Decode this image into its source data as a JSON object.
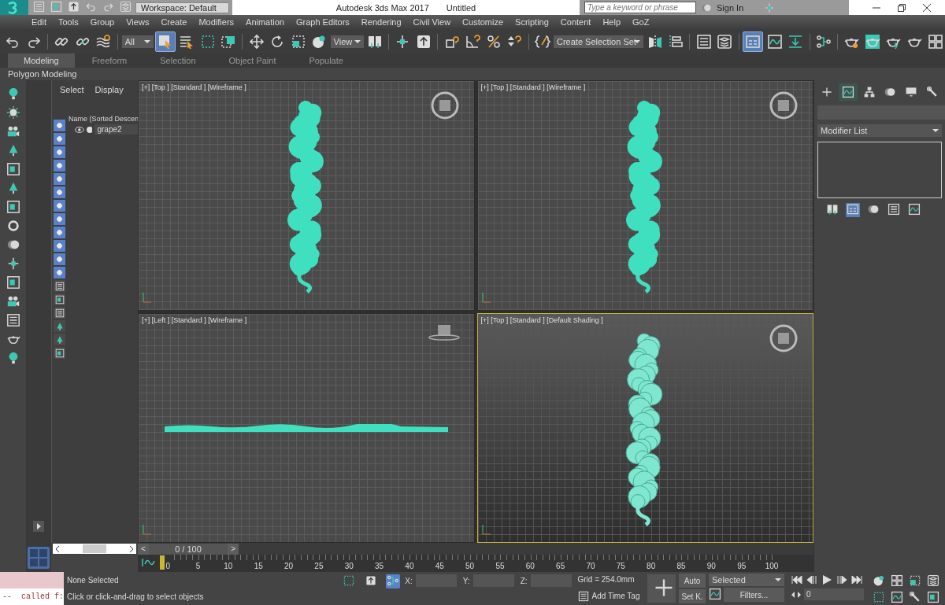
{
  "title_bar": {
    "workspace": "Workspace: Default",
    "app_title": "Autodesk 3ds Max 2017",
    "document": "Untitled",
    "search": {
      "placeholder": "Type a keyword or phrase"
    },
    "sign_in": "Sign In"
  },
  "menu": [
    "Edit",
    "Tools",
    "Group",
    "Views",
    "Create",
    "Modifiers",
    "Animation",
    "Graph Editors",
    "Rendering",
    "Civil View",
    "Customize",
    "Scripting",
    "Content",
    "Help",
    "GoZ"
  ],
  "main_toolbar": [
    {
      "kind": "undo",
      "selected": false
    },
    {
      "kind": "redo",
      "selected": false
    },
    {
      "kind": "sep"
    },
    {
      "kind": "link",
      "selected": false
    },
    {
      "kind": "unlink",
      "selected": false
    },
    {
      "kind": "wave",
      "selected": false
    },
    {
      "kind": "sep"
    },
    {
      "kind": "dropdown",
      "value": "All"
    },
    {
      "kind": "cursor",
      "selected": true
    },
    {
      "kind": "listcursor",
      "selected": false
    },
    {
      "kind": "dashrect",
      "selected": false
    },
    {
      "kind": "dashfill",
      "selected": false
    },
    {
      "kind": "sep"
    },
    {
      "kind": "move",
      "selected": false
    },
    {
      "kind": "rotate",
      "selected": false
    },
    {
      "kind": "scale",
      "selected": false
    },
    {
      "kind": "sphere",
      "selected": false
    },
    {
      "kind": "dropdown",
      "value": "View"
    },
    {
      "kind": "pivot",
      "selected": false
    },
    {
      "kind": "sep"
    },
    {
      "kind": "cross",
      "selected": false
    },
    {
      "kind": "upload",
      "selected": false
    },
    {
      "kind": "sep"
    },
    {
      "kind": "snap",
      "selected": false
    },
    {
      "kind": "angle",
      "selected": false
    },
    {
      "kind": "percent",
      "selected": false
    },
    {
      "kind": "spinner",
      "selected": false
    },
    {
      "kind": "sep"
    },
    {
      "kind": "braces",
      "selected": false
    },
    {
      "kind": "dropdown",
      "value": "Create Selection Set"
    },
    {
      "kind": "mirror",
      "selected": false
    },
    {
      "kind": "align",
      "selected": false
    },
    {
      "kind": "sep"
    },
    {
      "kind": "table",
      "selected": false
    },
    {
      "kind": "layers",
      "selected": false
    },
    {
      "kind": "sep"
    },
    {
      "kind": "ribbon",
      "selected": true
    },
    {
      "kind": "curve",
      "selected": false
    },
    {
      "kind": "download",
      "selected": false
    },
    {
      "kind": "sep"
    },
    {
      "kind": "nodes",
      "selected": false
    },
    {
      "kind": "sep"
    },
    {
      "kind": "teapotgear",
      "selected": false
    },
    {
      "kind": "teapotwindow",
      "selected": false
    },
    {
      "kind": "teapotbolt",
      "selected": false
    },
    {
      "kind": "teapot",
      "selected": false
    },
    {
      "kind": "imagegrid",
      "selected": false
    }
  ],
  "ribbon_tabs": [
    {
      "label": "Modeling",
      "selected": true
    },
    {
      "label": "Freeform",
      "selected": false
    },
    {
      "label": "Selection",
      "selected": false
    },
    {
      "label": "Object Paint",
      "selected": false
    },
    {
      "label": "Populate",
      "selected": false
    }
  ],
  "ribbon_panel": "Polygon Modeling",
  "scene_explorer": {
    "tabs": [
      "Select",
      "Display"
    ],
    "column_header": "Name (Sorted Descen",
    "filters": [
      {
        "on": true
      },
      {
        "on": true
      },
      {
        "on": true
      },
      {
        "on": true
      },
      {
        "on": true
      },
      {
        "on": true
      },
      {
        "on": true
      },
      {
        "on": true
      },
      {
        "on": true
      },
      {
        "on": true
      },
      {
        "on": true
      },
      {
        "on": true
      }
    ],
    "rows": [
      {
        "name": "grape2",
        "visible": true
      }
    ]
  },
  "viewports": [
    {
      "label": "[+] [Top ] [Standard ] [Wireframe ]",
      "kind": "top",
      "selected": false
    },
    {
      "label": "[+] [Top ] [Standard ] [Wireframe ]",
      "kind": "top",
      "selected": false
    },
    {
      "label": "[+] [Left ] [Standard ] [Wireframe ]",
      "kind": "side",
      "selected": false
    },
    {
      "label": "[+] [Top ] [Standard ] [Default Shading ]",
      "kind": "shaded",
      "selected": true
    }
  ],
  "command_panel": {
    "tabs": [
      {
        "kind": "plus",
        "selected": false
      },
      {
        "kind": "curve",
        "selected": true
      },
      {
        "kind": "hierarchy",
        "selected": false
      },
      {
        "kind": "motion",
        "selected": false
      },
      {
        "kind": "display",
        "selected": false
      },
      {
        "kind": "wrench",
        "selected": false
      }
    ],
    "modifier_list": "Modifier List"
  },
  "time_slider": {
    "prev": "<",
    "position": "0 / 100",
    "next": ">",
    "level": 0
  },
  "track_bar": {
    "ticks": [
      "0",
      "5",
      "10",
      "15",
      "20",
      "25",
      "30",
      "35",
      "40",
      "45",
      "50",
      "55",
      "60",
      "65",
      "70",
      "75",
      "80",
      "85",
      "90",
      "95",
      "100"
    ]
  },
  "status_bar": {
    "listener": "--  called f:",
    "selection": "None Selected",
    "prompt": "Click or click-and-drag to select objects",
    "coords": [
      "X:",
      "Y:",
      "Z:"
    ],
    "grid": "Grid = 254.0mm",
    "time_tag": "Add Time Tag",
    "auto_key": "Auto",
    "set_key": "Set K.",
    "key_filter": "Selected",
    "filters": "Filters...",
    "frame": "0"
  }
}
